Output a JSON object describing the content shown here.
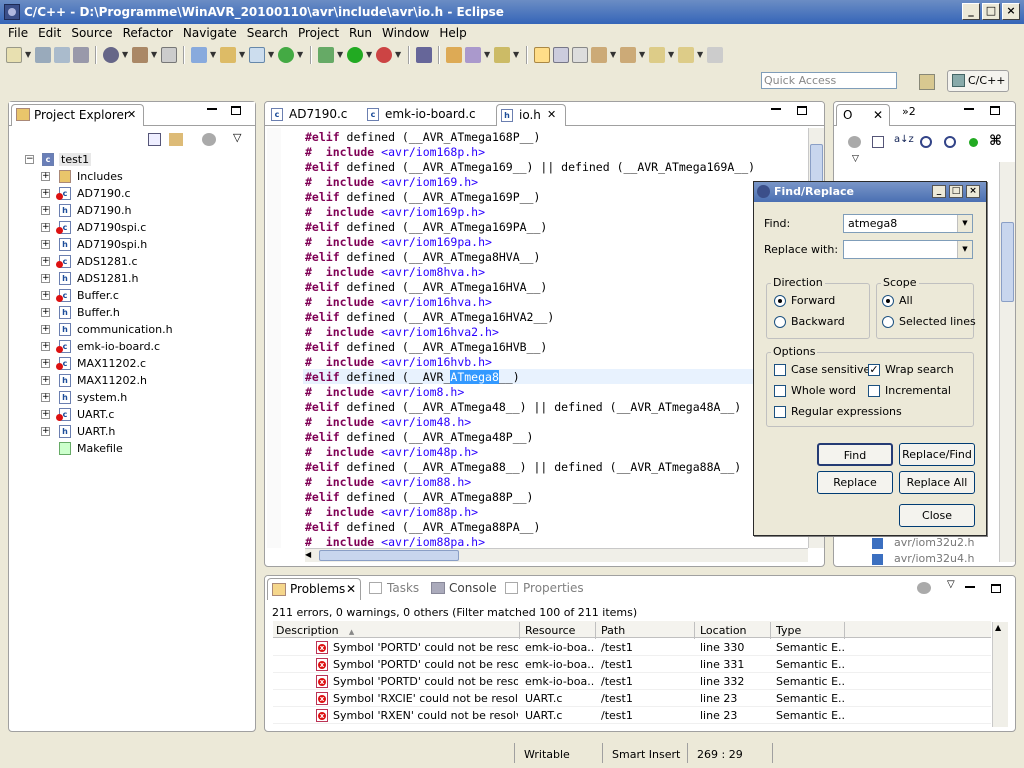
{
  "window": {
    "title": "C/C++ - D:\\Programme\\WinAVR_20100110\\avr\\include\\avr\\io.h - Eclipse",
    "min": "_",
    "max": "□",
    "close": "×"
  },
  "menu": [
    "File",
    "Edit",
    "Source",
    "Refactor",
    "Navigate",
    "Search",
    "Project",
    "Run",
    "Window",
    "Help"
  ],
  "quick_access": {
    "placeholder": "Quick Access"
  },
  "perspective": {
    "label": "C/C++"
  },
  "project_explorer": {
    "title": "Project Explorer",
    "project": "test1",
    "items": [
      "Includes",
      "AD7190.c",
      "AD7190.h",
      "AD7190spi.c",
      "AD7190spi.h",
      "ADS1281.c",
      "ADS1281.h",
      "Buffer.c",
      "Buffer.h",
      "communication.h",
      "emk-io-board.c",
      "MAX11202.c",
      "MAX11202.h",
      "system.h",
      "UART.c",
      "UART.h",
      "Makefile"
    ]
  },
  "editor": {
    "tabs": [
      "AD7190.c",
      "emk-io-board.c",
      "io.h"
    ],
    "lines": [
      {
        "a": "#elif",
        "b": " defined (__AVR_ATmega168P__)"
      },
      {
        "a": "#  include",
        "b": " <avr/iom168p.h>"
      },
      {
        "a": "#elif",
        "b": " defined (__AVR_ATmega169__) || defined (__AVR_ATmega169A__)"
      },
      {
        "a": "#  include",
        "b": " <avr/iom169.h>"
      },
      {
        "a": "#elif",
        "b": " defined (__AVR_ATmega169P__)"
      },
      {
        "a": "#  include",
        "b": " <avr/iom169p.h>"
      },
      {
        "a": "#elif",
        "b": " defined (__AVR_ATmega169PA__)"
      },
      {
        "a": "#  include",
        "b": " <avr/iom169pa.h>"
      },
      {
        "a": "#elif",
        "b": " defined (__AVR_ATmega8HVA__)"
      },
      {
        "a": "#  include",
        "b": " <avr/iom8hva.h>"
      },
      {
        "a": "#elif",
        "b": " defined (__AVR_ATmega16HVA__)"
      },
      {
        "a": "#  include",
        "b": " <avr/iom16hva.h>"
      },
      {
        "a": "#elif",
        "b": " defined (__AVR_ATmega16HVA2__)"
      },
      {
        "a": "#  include",
        "b": " <avr/iom16hva2.h>"
      },
      {
        "a": "#elif",
        "b": " defined (__AVR_ATmega16HVB__)"
      },
      {
        "a": "#  include",
        "b": " <avr/iom16hvb.h>"
      },
      {
        "a": "#elif",
        "b": " defined (__AVR_",
        "sel": "ATmega8",
        "c": "__)"
      },
      {
        "a": "#  include",
        "b": " <avr/iom8.h>"
      },
      {
        "a": "#elif",
        "b": " defined (__AVR_ATmega48__) || defined (__AVR_ATmega48A__)"
      },
      {
        "a": "#  include",
        "b": " <avr/iom48.h>"
      },
      {
        "a": "#elif",
        "b": " defined (__AVR_ATmega48P__)"
      },
      {
        "a": "#  include",
        "b": " <avr/iom48p.h>"
      },
      {
        "a": "#elif",
        "b": " defined (__AVR_ATmega88__) || defined (__AVR_ATmega88A__)"
      },
      {
        "a": "#  include",
        "b": " <avr/iom88.h>"
      },
      {
        "a": "#elif",
        "b": " defined (__AVR_ATmega88P__)"
      },
      {
        "a": "#  include",
        "b": " <avr/iom88p.h>"
      },
      {
        "a": "#elif",
        "b": " defined (__AVR_ATmega88PA__)"
      },
      {
        "a": "#  include",
        "b": " <avr/iom88pa.h>"
      }
    ]
  },
  "outline": {
    "tab_label": "O",
    "tab2": "»2",
    "items": [
      "avr/iom32u2.h",
      "avr/iom32u4.h"
    ]
  },
  "find_replace": {
    "title": "Find/Replace",
    "find_label": "Find:",
    "find_value": "atmega8",
    "replace_label": "Replace with:",
    "replace_value": "",
    "direction_label": "Direction",
    "forward": "Forward",
    "backward": "Backward",
    "scope_label": "Scope",
    "all": "All",
    "selected_lines": "Selected lines",
    "options_label": "Options",
    "case_sensitive": "Case sensitive",
    "wrap_search": "Wrap search",
    "whole_word": "Whole word",
    "incremental": "Incremental",
    "regex": "Regular expressions",
    "buttons": {
      "find": "Find",
      "replace_find": "Replace/Find",
      "replace": "Replace",
      "replace_all": "Replace All",
      "close": "Close"
    }
  },
  "problems": {
    "tabs": [
      "Problems",
      "Tasks",
      "Console",
      "Properties"
    ],
    "summary": "211 errors, 0 warnings, 0 others (Filter matched 100 of 211 items)",
    "columns": [
      "Description",
      "Resource",
      "Path",
      "Location",
      "Type"
    ],
    "rows": [
      [
        "Symbol 'PORTD' could not be resolved",
        "emk-io-boa...",
        "/test1",
        "line 330",
        "Semantic E..."
      ],
      [
        "Symbol 'PORTD' could not be resolved",
        "emk-io-boa...",
        "/test1",
        "line 331",
        "Semantic E..."
      ],
      [
        "Symbol 'PORTD' could not be resolved",
        "emk-io-boa...",
        "/test1",
        "line 332",
        "Semantic E..."
      ],
      [
        "Symbol 'RXCIE' could not be resolved",
        "UART.c",
        "/test1",
        "line 23",
        "Semantic E..."
      ],
      [
        "Symbol 'RXEN' could not be resolved",
        "UART.c",
        "/test1",
        "line 23",
        "Semantic E..."
      ]
    ]
  },
  "status": {
    "writable": "Writable",
    "insert": "Smart Insert",
    "position": "269 : 29"
  },
  "colors": {
    "keyword": "#7f0055",
    "include": "#2a00ff",
    "selection": "#3399ff",
    "title_bar": "#3565b8"
  }
}
